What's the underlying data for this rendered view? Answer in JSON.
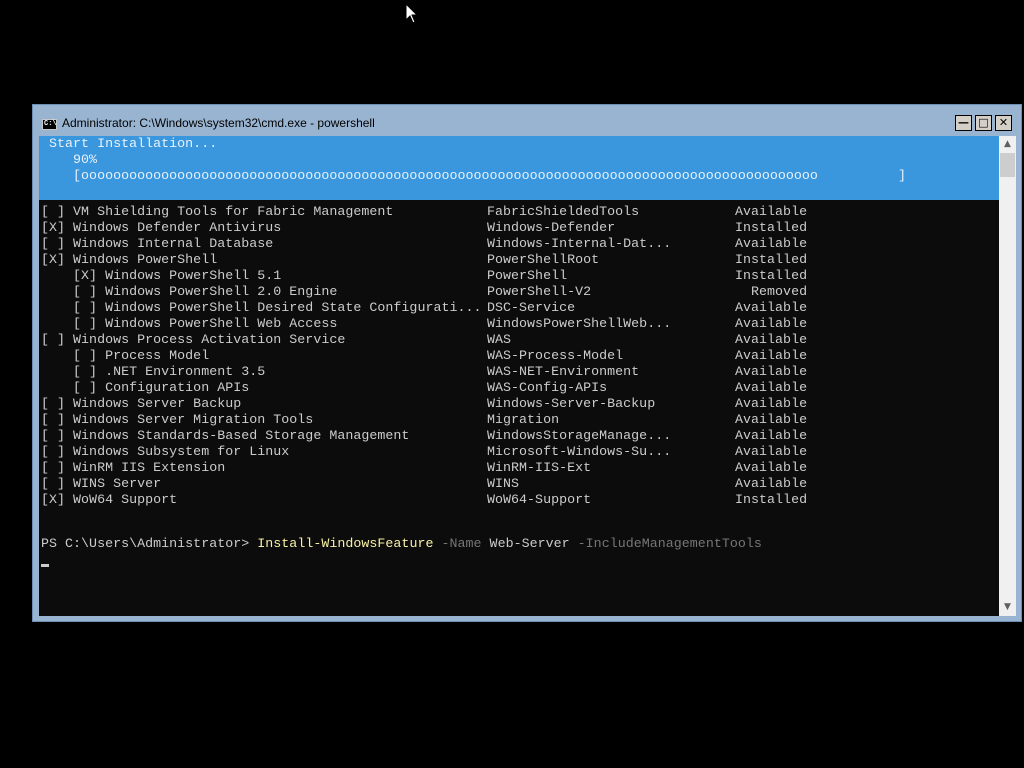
{
  "window": {
    "title": "Administrator: C:\\Windows\\system32\\cmd.exe - powershell",
    "icon_text": "C:\\",
    "controls": {
      "minimize": "—",
      "maximize": "□",
      "close": "✕"
    }
  },
  "progress": {
    "heading": " Start Installation...",
    "percent_text": "    90%",
    "bar_text": "    [oooooooooooooooooooooooooooooooooooooooooooooooooooooooooooooooooooooooooooooooooooooooooooo          ]",
    "percent": 90
  },
  "features": [
    {
      "display": "[ ] VM Shielding Tools for Fabric Management",
      "name": "FabricShieldedTools",
      "state": "Available"
    },
    {
      "display": "[X] Windows Defender Antivirus",
      "name": "Windows-Defender",
      "state": "Installed"
    },
    {
      "display": "[ ] Windows Internal Database",
      "name": "Windows-Internal-Dat...",
      "state": "Available"
    },
    {
      "display": "[X] Windows PowerShell",
      "name": "PowerShellRoot",
      "state": "Installed"
    },
    {
      "display": "    [X] Windows PowerShell 5.1",
      "name": "PowerShell",
      "state": "Installed"
    },
    {
      "display": "    [ ] Windows PowerShell 2.0 Engine",
      "name": "PowerShell-V2",
      "state": "  Removed"
    },
    {
      "display": "    [ ] Windows PowerShell Desired State Configurati...",
      "name": "DSC-Service",
      "state": "Available"
    },
    {
      "display": "    [ ] Windows PowerShell Web Access",
      "name": "WindowsPowerShellWeb...",
      "state": "Available"
    },
    {
      "display": "[ ] Windows Process Activation Service",
      "name": "WAS",
      "state": "Available"
    },
    {
      "display": "    [ ] Process Model",
      "name": "WAS-Process-Model",
      "state": "Available"
    },
    {
      "display": "    [ ] .NET Environment 3.5",
      "name": "WAS-NET-Environment",
      "state": "Available"
    },
    {
      "display": "    [ ] Configuration APIs",
      "name": "WAS-Config-APIs",
      "state": "Available"
    },
    {
      "display": "[ ] Windows Server Backup",
      "name": "Windows-Server-Backup",
      "state": "Available"
    },
    {
      "display": "[ ] Windows Server Migration Tools",
      "name": "Migration",
      "state": "Available"
    },
    {
      "display": "[ ] Windows Standards-Based Storage Management",
      "name": "WindowsStorageManage...",
      "state": "Available"
    },
    {
      "display": "[ ] Windows Subsystem for Linux",
      "name": "Microsoft-Windows-Su...",
      "state": "Available"
    },
    {
      "display": "[ ] WinRM IIS Extension",
      "name": "WinRM-IIS-Ext",
      "state": "Available"
    },
    {
      "display": "[ ] WINS Server",
      "name": "WINS",
      "state": "Available"
    },
    {
      "display": "[X] WoW64 Support",
      "name": "WoW64-Support",
      "state": "Installed"
    }
  ],
  "prompt": {
    "path": "PS C:\\Users\\Administrator> ",
    "cmdlet": "Install-WindowsFeature",
    "param1": " -Name",
    "value1": " Web-Server",
    "param2": " -IncludeManagementTools"
  },
  "scrollbar": {
    "up_arrow": "▲",
    "down_arrow": "▼"
  },
  "colors": {
    "desktop": "#000000",
    "console_bg": "#0c0c0c",
    "console_text": "#cccccc",
    "progress_bg": "#3a96dd",
    "cmdlet_yellow": "#f9f1a5",
    "param_gray": "#767676",
    "window_frame": "#99b4d1"
  }
}
